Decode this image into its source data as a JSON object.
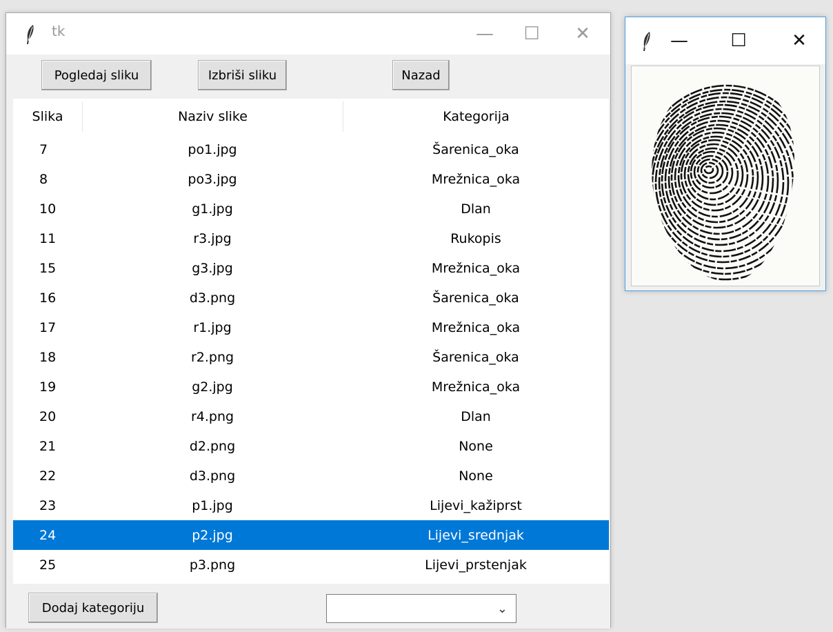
{
  "main_window": {
    "title": "tk",
    "controls": {
      "minimize": "—",
      "maximize": "☐",
      "close": "✕"
    },
    "toolbar": {
      "view_label": "Pogledaj sliku",
      "delete_label": "Izbriši sliku",
      "back_label": "Nazad"
    },
    "table": {
      "columns": [
        "Slika",
        "Naziv slike",
        "Kategorija"
      ],
      "rows": [
        [
          "7",
          "po1.jpg",
          "Šarenica_oka"
        ],
        [
          "8",
          "po3.jpg",
          "Mrežnica_oka"
        ],
        [
          "10",
          "g1.jpg",
          "Dlan"
        ],
        [
          "11",
          "r3.jpg",
          "Rukopis"
        ],
        [
          "15",
          "g3.jpg",
          "Mrežnica_oka"
        ],
        [
          "16",
          "d3.png",
          "Šarenica_oka"
        ],
        [
          "17",
          "r1.jpg",
          "Mrežnica_oka"
        ],
        [
          "18",
          "r2.png",
          "Šarenica_oka"
        ],
        [
          "19",
          "g2.jpg",
          "Mrežnica_oka"
        ],
        [
          "20",
          "r4.png",
          "Dlan"
        ],
        [
          "21",
          "d2.png",
          "None"
        ],
        [
          "22",
          "d3.png",
          "None"
        ],
        [
          "23",
          "p1.jpg",
          "Lijevi_kažiprst"
        ],
        [
          "24",
          "p2.jpg",
          "Lijevi_srednjak"
        ],
        [
          "25",
          "p3.png",
          "Lijevi_prstenjak"
        ]
      ],
      "selected_row": 13
    },
    "bottom": {
      "add_category_label": "Dodaj kategoriju",
      "category_select_value": ""
    }
  },
  "image_window": {
    "controls": {
      "minimize": "—",
      "maximize": "☐",
      "close": "✕"
    },
    "image": "fingerprint"
  },
  "colors": {
    "selection": "#0078d7",
    "window_bg": "#f0f0f0",
    "desktop_bg": "#e6e6e6",
    "image_window_border": "#4a9fe0"
  }
}
